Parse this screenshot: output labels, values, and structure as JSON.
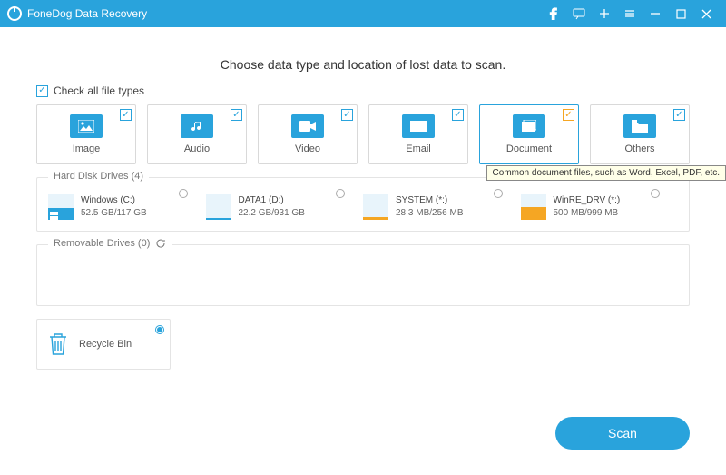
{
  "titlebar": {
    "app_name": "FoneDog Data Recovery"
  },
  "headline": "Choose data type and location of lost data to scan.",
  "check_all_label": "Check all file types",
  "types": {
    "image": {
      "label": "Image",
      "icon": "image-icon"
    },
    "audio": {
      "label": "Audio",
      "icon": "audio-icon"
    },
    "video": {
      "label": "Video",
      "icon": "video-icon"
    },
    "email": {
      "label": "Email",
      "icon": "email-icon"
    },
    "document": {
      "label": "Document",
      "icon": "document-icon"
    },
    "others": {
      "label": "Others",
      "icon": "others-icon"
    }
  },
  "tooltip_document": "Common document files, such as Word, Excel, PDF, etc.",
  "sections": {
    "hdd_label": "Hard Disk Drives (4)",
    "removable_label": "Removable Drives (0)"
  },
  "drives": [
    {
      "name": "Windows (C:)",
      "usage": "52.5 GB/117 GB",
      "fill_pct": 45,
      "color": "blue",
      "os": true
    },
    {
      "name": "DATA1 (D:)",
      "usage": "22.2 GB/931 GB",
      "fill_pct": 6,
      "color": "blue",
      "os": false
    },
    {
      "name": "SYSTEM (*:)",
      "usage": "28.3 MB/256 MB",
      "fill_pct": 12,
      "color": "orange",
      "os": false
    },
    {
      "name": "WinRE_DRV (*:)",
      "usage": "500 MB/999 MB",
      "fill_pct": 50,
      "color": "orange",
      "os": false
    }
  ],
  "recycle": {
    "label": "Recycle Bin"
  },
  "scan_label": "Scan",
  "colors": {
    "primary": "#29a3dc",
    "accent": "#f5a623"
  }
}
